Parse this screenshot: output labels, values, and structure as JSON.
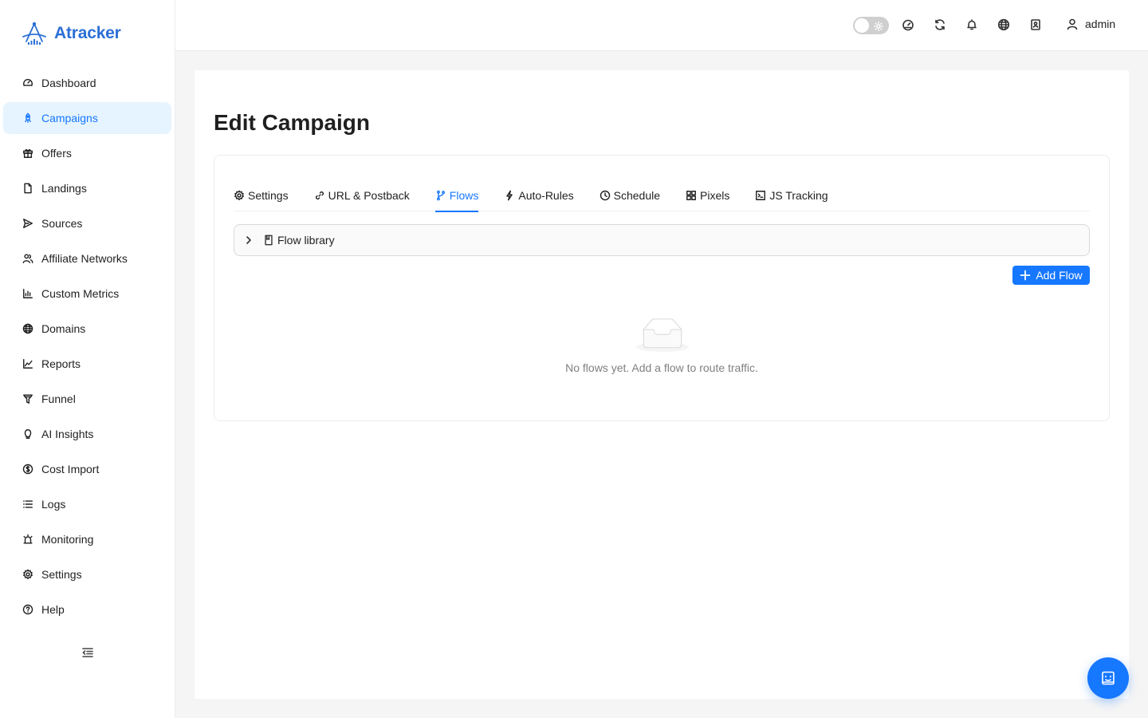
{
  "app": {
    "name": "Atracker"
  },
  "sidebar": {
    "items": [
      {
        "label": "Dashboard",
        "icon": "dashboard-icon",
        "active": false
      },
      {
        "label": "Campaigns",
        "icon": "rocket-icon",
        "active": true
      },
      {
        "label": "Offers",
        "icon": "gift-icon",
        "active": false
      },
      {
        "label": "Landings",
        "icon": "file-icon",
        "active": false
      },
      {
        "label": "Sources",
        "icon": "send-icon",
        "active": false
      },
      {
        "label": "Affiliate Networks",
        "icon": "users-icon",
        "active": false
      },
      {
        "label": "Custom Metrics",
        "icon": "bar-chart-icon",
        "active": false
      },
      {
        "label": "Domains",
        "icon": "globe-icon",
        "active": false
      },
      {
        "label": "Reports",
        "icon": "line-chart-icon",
        "active": false
      },
      {
        "label": "Funnel",
        "icon": "funnel-icon",
        "active": false
      },
      {
        "label": "AI Insights",
        "icon": "bulb-icon",
        "active": false
      },
      {
        "label": "Cost Import",
        "icon": "dollar-icon",
        "active": false
      },
      {
        "label": "Logs",
        "icon": "list-icon",
        "active": false
      },
      {
        "label": "Monitoring",
        "icon": "alarm-icon",
        "active": false
      },
      {
        "label": "Settings",
        "icon": "gear-icon",
        "active": false
      },
      {
        "label": "Help",
        "icon": "question-icon",
        "active": false
      }
    ]
  },
  "header": {
    "user": "admin",
    "icons": [
      "dashboard-icon",
      "sync-icon",
      "bell-icon",
      "globe-icon",
      "contacts-icon"
    ]
  },
  "page": {
    "title": "Edit Campaign",
    "tabs": [
      {
        "label": "Settings",
        "icon": "gear-icon",
        "active": false
      },
      {
        "label": "URL & Postback",
        "icon": "link-icon",
        "active": false
      },
      {
        "label": "Flows",
        "icon": "branch-icon",
        "active": true
      },
      {
        "label": "Auto-Rules",
        "icon": "thunderbolt-icon",
        "active": false
      },
      {
        "label": "Schedule",
        "icon": "clock-icon",
        "active": false
      },
      {
        "label": "Pixels",
        "icon": "grid-icon",
        "active": false
      },
      {
        "label": "JS Tracking",
        "icon": "code-icon",
        "active": false
      }
    ],
    "flow_library_label": "Flow library",
    "add_flow_label": "Add Flow",
    "empty_text": "No flows yet. Add a flow to route traffic."
  },
  "colors": {
    "accent": "#1677ff",
    "brand": "#2b6fd6",
    "active_bg": "#e6f4ff"
  }
}
